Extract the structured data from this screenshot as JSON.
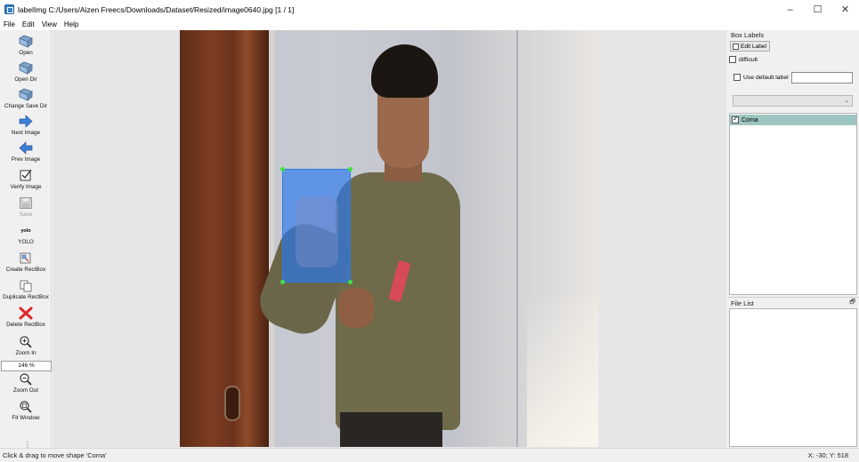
{
  "window": {
    "title": "labelImg C:/Users/Aizen Freecs/Downloads/Dataset/Resized/image0640.jpg [1 / 1]",
    "controls": {
      "minimize": "‒",
      "maximize": "☐",
      "close": "✕"
    }
  },
  "menu": [
    "File",
    "Edit",
    "View",
    "Help"
  ],
  "toolbar": {
    "open": "Open",
    "open_dir": "Open Dir",
    "change_save_dir": "Change Save Dir",
    "next_image": "Next Image",
    "prev_image": "Prev Image",
    "verify_image": "Verify Image",
    "save": "Save",
    "format_icon_text": "yolo",
    "format": "YOLO",
    "create_rectbox": "Create RectBox",
    "duplicate_rectbox": "Duplicate RectBox",
    "delete_rectbox": "Delete RectBox",
    "zoom_in": "Zoom In",
    "zoom_value": "146 %",
    "zoom_out": "Zoom Out",
    "fit_window": "Fit Window",
    "more": "⋮"
  },
  "box_labels": {
    "title": "Box Labels",
    "edit_label": "Edit Label",
    "difficult": "difficult",
    "difficult_checked": false,
    "use_default_label": "Use default label",
    "use_default_checked": false,
    "default_label_value": "",
    "combo_value": "",
    "labels": [
      {
        "text": "Coma",
        "checked": true
      }
    ]
  },
  "file_list": {
    "title": "File List",
    "float_icon": "🗗"
  },
  "status": {
    "message": "Click & drag to move shape 'Coma'",
    "position": "X: -30; Y: 518"
  },
  "colors": {
    "bbox": "#2878f0",
    "selected_label": "#9dc5c2",
    "vertex": "#3fe23f"
  }
}
